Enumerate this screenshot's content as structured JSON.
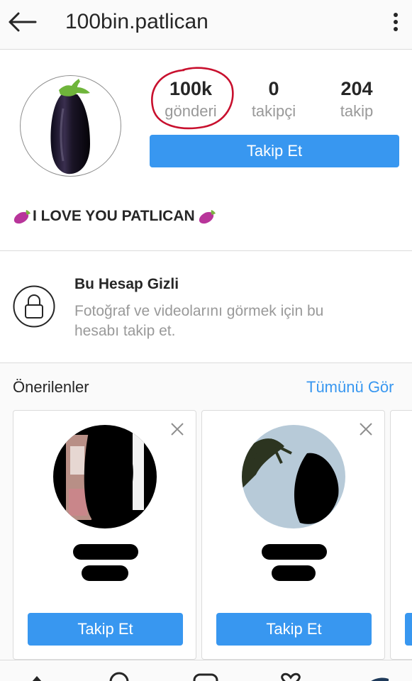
{
  "header": {
    "title": "100bin.patlican",
    "back_icon": "arrow-left-icon",
    "more_icon": "more-vertical-icon"
  },
  "profile": {
    "stats": [
      {
        "value": "100k",
        "label": "gönderi"
      },
      {
        "value": "0",
        "label": "takipçi"
      },
      {
        "value": "204",
        "label": "takip"
      }
    ],
    "follow_label": "Takip Et",
    "bio": "I LOVE YOU PATLICAN",
    "bio_emoji": "eggplant-emoji"
  },
  "private": {
    "title": "Bu Hesap Gizli",
    "description": "Fotoğraf ve videolarını görmek için bu hesabı takip et.",
    "icon": "lock-icon"
  },
  "suggestions": {
    "title": "Önerilenler",
    "see_all": "Tümünü Gör",
    "cards": [
      {
        "follow_label": "Takip Et"
      },
      {
        "follow_label": "Takip Et"
      }
    ]
  },
  "colors": {
    "accent": "#3897f0",
    "annotation": "#c8102e",
    "muted": "#999999"
  },
  "bottom_nav": {
    "icons": [
      "home-icon",
      "search-icon",
      "add-icon",
      "heart-icon",
      "profile-icon"
    ]
  }
}
